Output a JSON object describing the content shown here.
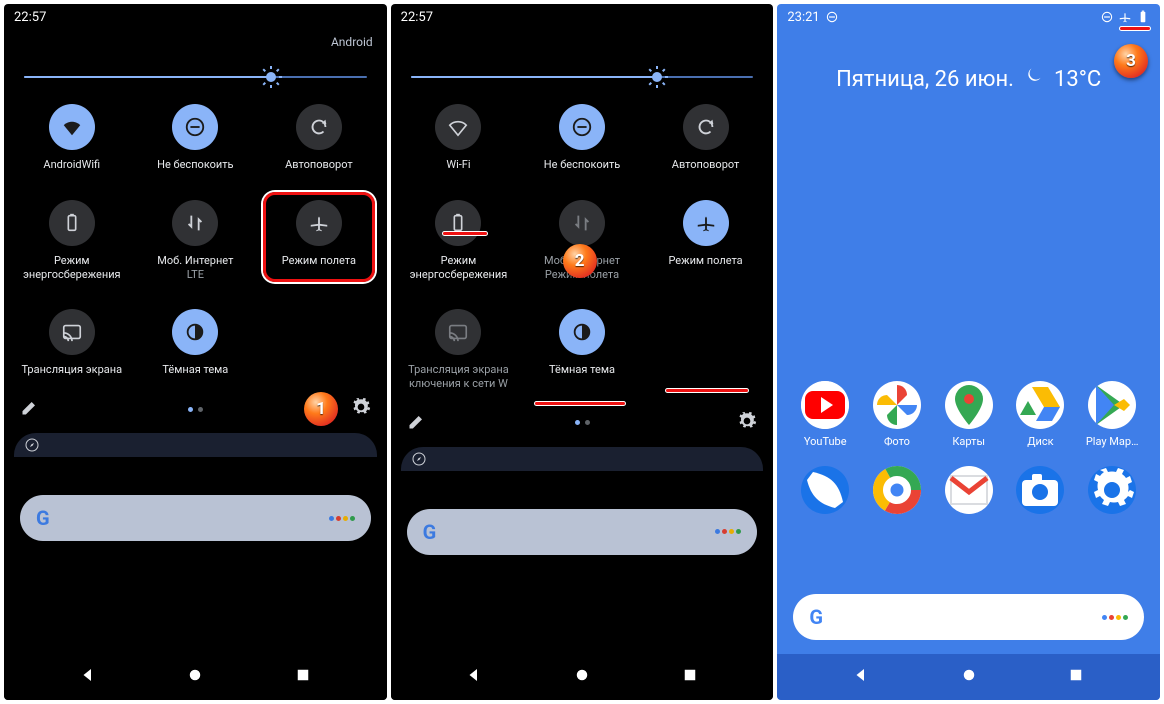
{
  "panels": {
    "left": {
      "time": "22:57",
      "network_carrier": "Android",
      "brightness_percent": 72,
      "tiles": {
        "row1": [
          {
            "label": "AndroidWifi",
            "on": true
          },
          {
            "label": "Не беспокоить",
            "on": true
          },
          {
            "label": "Автоповорот",
            "on": false
          }
        ],
        "row2": [
          {
            "label": "Режим энергосбережения",
            "on": false
          },
          {
            "label": "Моб. Интернет",
            "sub": "LTE",
            "on": false
          },
          {
            "label": "Режим полета",
            "on": false
          }
        ],
        "row3": [
          {
            "label": "Трансляция экрана",
            "on": false
          },
          {
            "label": "Тёмная тема",
            "on": true
          }
        ]
      },
      "pin": "1"
    },
    "mid": {
      "time": "22:57",
      "brightness_percent": 72,
      "tiles": {
        "row1": [
          {
            "label": "Wi-Fi",
            "on": false
          },
          {
            "label": "Не беспокоить",
            "on": true
          },
          {
            "label": "Автоповорот",
            "on": false
          }
        ],
        "row2": [
          {
            "label": "Режим энергосбережения",
            "on": false
          },
          {
            "label": "Моб. Интернет",
            "sub": "Режим полета",
            "dim": true,
            "on": false
          },
          {
            "label": "Режим полета",
            "on": true
          }
        ],
        "row3": [
          {
            "label": "Трансляция экрана",
            "sub": "ключения к сети W",
            "dim": true,
            "on": false
          },
          {
            "label": "Тёмная тема",
            "on": true
          }
        ]
      },
      "pin": "2"
    },
    "right": {
      "time": "23:21",
      "date": "Пятница, 26 июн.",
      "temperature": "13°C",
      "apps": [
        {
          "label": "YouTube",
          "color": "#ff0000",
          "icon": "youtube"
        },
        {
          "label": "Фото",
          "icon": "photos"
        },
        {
          "label": "Карты",
          "icon": "maps"
        },
        {
          "label": "Диск",
          "icon": "drive"
        },
        {
          "label": "Play Мар…",
          "icon": "play"
        },
        {
          "label": "",
          "icon": "phone",
          "color": "#1a73e8"
        },
        {
          "label": "",
          "icon": "chrome"
        },
        {
          "label": "",
          "icon": "gmail"
        },
        {
          "label": "",
          "icon": "camera",
          "color": "#1a73e8"
        },
        {
          "label": "",
          "icon": "settings",
          "color": "#1a73e8"
        }
      ],
      "pin": "3"
    }
  },
  "search_placeholder": "G",
  "icons": {
    "edit": "edit-icon",
    "gear": "gear-icon"
  }
}
